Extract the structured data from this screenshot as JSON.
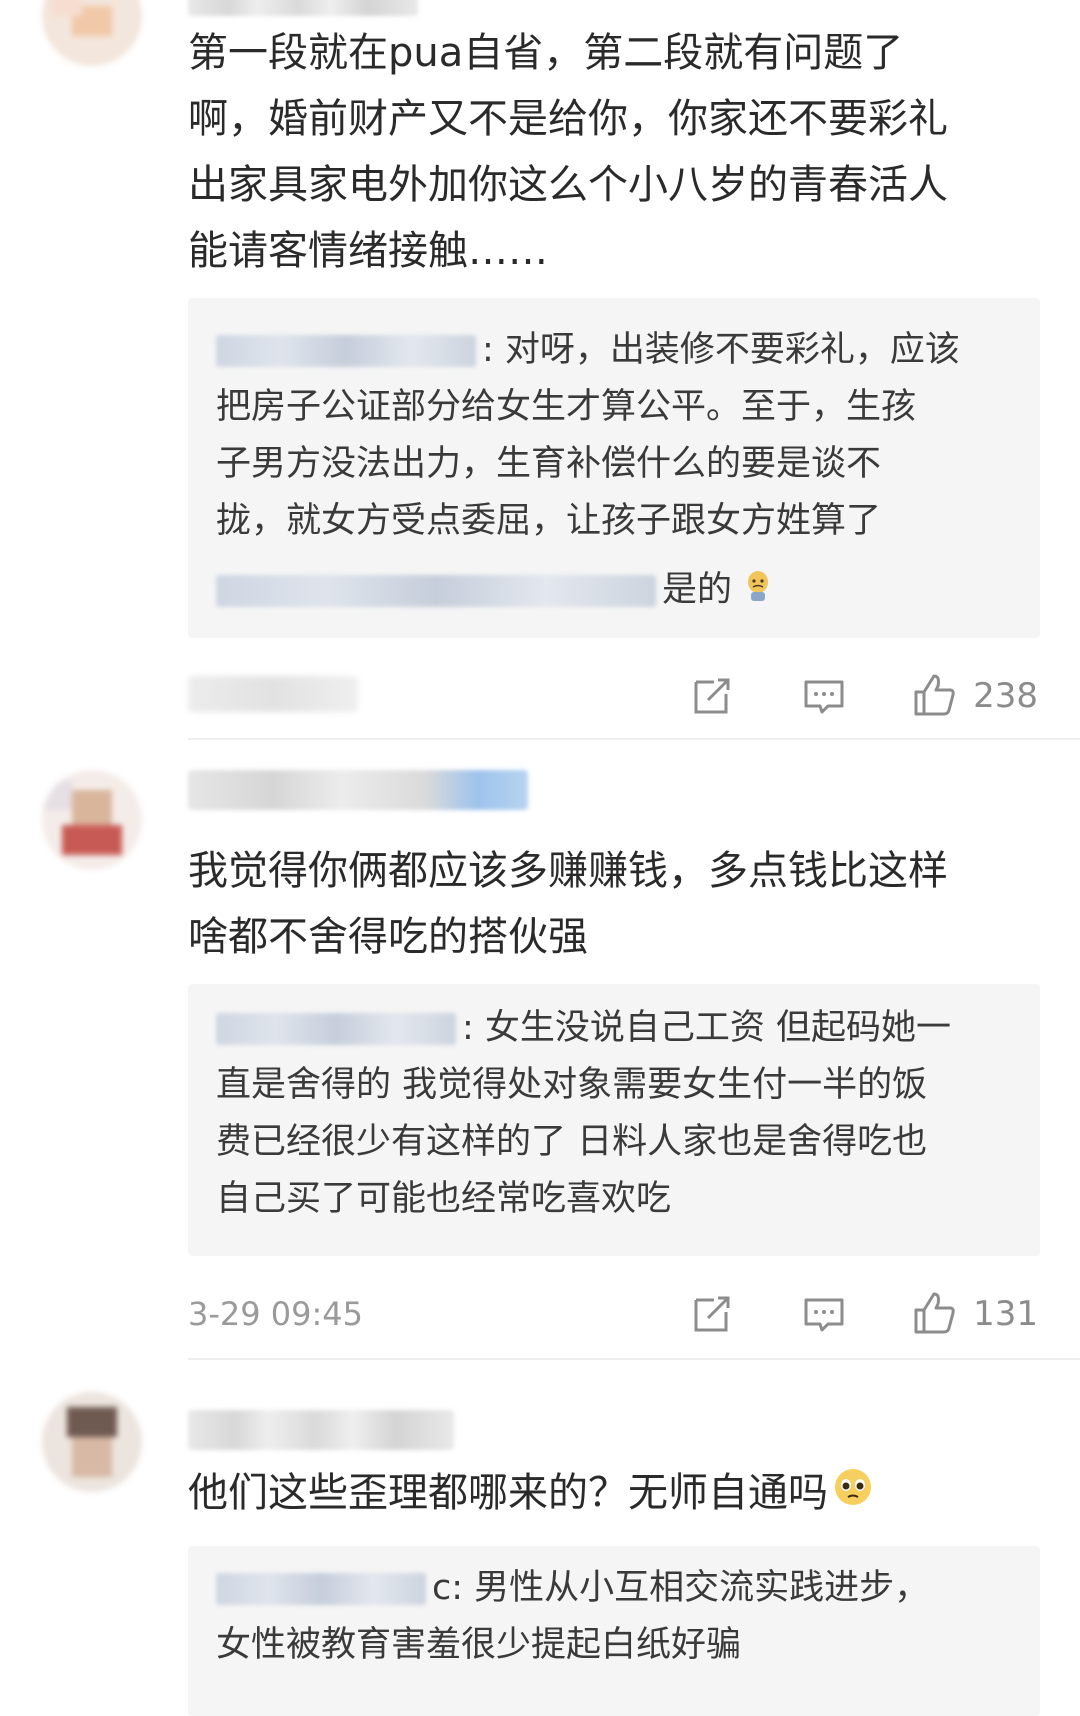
{
  "comments": [
    {
      "text_lines": [
        "第一段就在pua自省，第二段就有问题了",
        "啊，婚前财产又不是给你，你家还不要彩礼",
        "出家具家电外加你这么个小八岁的青春活人",
        "能请客情绪接触……"
      ],
      "reply_lines": [
        ": 对呀，出装修不要彩礼，应该",
        "把房子公证部分给女生才算公平。至于，生孩",
        "子男方没法出力，生育补偿什么的要是谈不",
        "拢，就女方受点委屈，让孩子跟女方姓算了"
      ],
      "sub_reply": "是的",
      "timestamp": "",
      "likes": "238"
    },
    {
      "text_lines": [
        "我觉得你俩都应该多赚赚钱，多点钱比这样",
        "啥都不舍得吃的搭伙强"
      ],
      "reply_lines": [
        ": 女生没说自己工资  但起码她一",
        "直是舍得的 我觉得处对象需要女生付一半的饭",
        "费已经很少有这样的了 日料人家也是舍得吃也",
        "自己买了可能也经常吃喜欢吃"
      ],
      "timestamp": "3-29 09:45",
      "likes": "131"
    },
    {
      "text_lines": [
        "他们这些歪理都哪来的？无师自通吗"
      ],
      "reply_lines": [
        "c: 男性从小互相交流实践进步，",
        "女性被教育害羞很少提起白纸好骗"
      ]
    }
  ],
  "icons": {
    "share": "share-icon",
    "comment": "comment-icon",
    "like": "like-icon"
  },
  "colors": {
    "reply_bg": "#f5f5f5",
    "meta_text": "#9a9a9a",
    "main_text": "#2a2a2a"
  }
}
